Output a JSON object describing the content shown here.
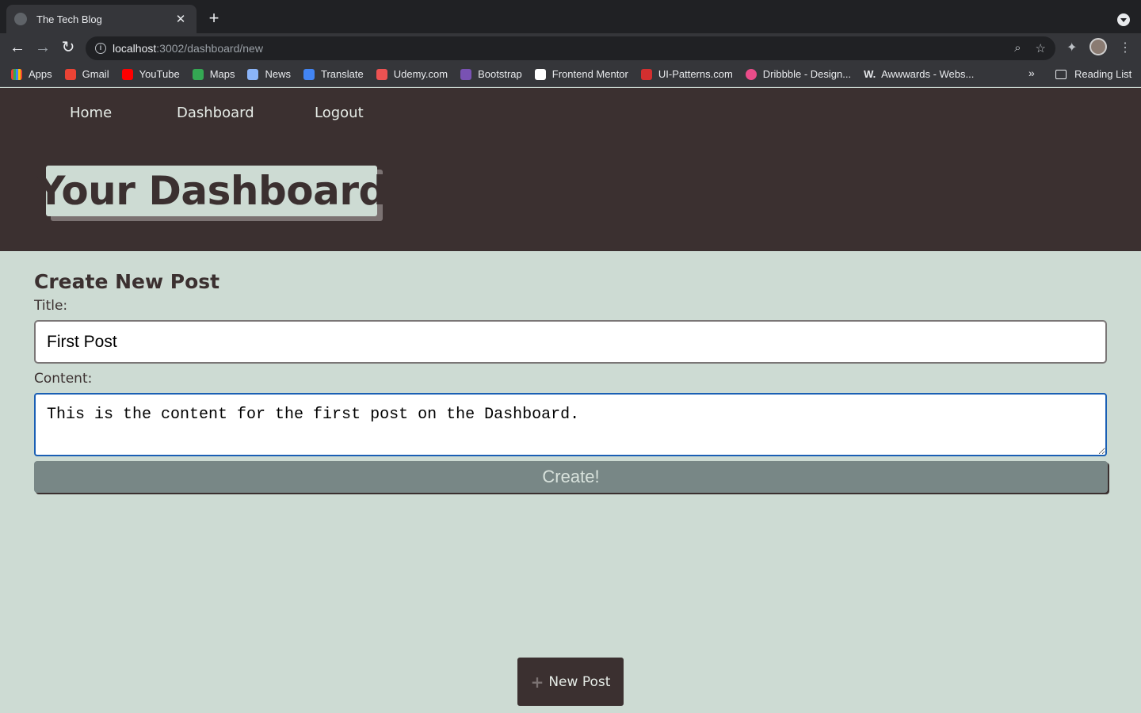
{
  "browser": {
    "tab_title": "The Tech Blog",
    "url_host": "localhost",
    "url_path": ":3002/dashboard/new",
    "bookmarks": [
      {
        "label": "Apps",
        "icon": "apps-grid-icon",
        "color": "#4285f4"
      },
      {
        "label": "Gmail",
        "icon": "gmail-icon",
        "color": "#ea4335"
      },
      {
        "label": "YouTube",
        "icon": "youtube-icon",
        "color": "#ff0000"
      },
      {
        "label": "Maps",
        "icon": "maps-icon",
        "color": "#34a853"
      },
      {
        "label": "News",
        "icon": "news-icon",
        "color": "#8ab4f8"
      },
      {
        "label": "Translate",
        "icon": "translate-icon",
        "color": "#4285f4"
      },
      {
        "label": "Udemy.com",
        "icon": "udemy-icon",
        "color": "#ec5252"
      },
      {
        "label": "Bootstrap",
        "icon": "bootstrap-icon",
        "color": "#7952b3"
      },
      {
        "label": "Frontend Mentor",
        "icon": "frontend-mentor-icon",
        "color": "#ffffff"
      },
      {
        "label": "UI-Patterns.com",
        "icon": "ui-patterns-icon",
        "color": "#d32f2f"
      },
      {
        "label": "Dribbble - Design...",
        "icon": "dribbble-icon",
        "color": "#ea4c89"
      },
      {
        "label": "Awwwards - Webs...",
        "icon": "awwwards-icon",
        "color": "#e8eaed"
      }
    ],
    "reading_list": "Reading List"
  },
  "nav": {
    "home": "Home",
    "dashboard": "Dashboard",
    "logout": "Logout"
  },
  "hero": {
    "title": "Your Dashboard"
  },
  "form": {
    "heading": "Create New Post",
    "title_label": "Title:",
    "title_value": "First Post",
    "content_label": "Content:",
    "content_value": "This is the content for the first post on the Dashboard.",
    "submit_label": "Create!"
  },
  "new_post_button": {
    "label": "New Post"
  },
  "colors": {
    "header_bg": "#3b3030",
    "page_bg": "#cddbd3",
    "button_bg": "#788786"
  }
}
